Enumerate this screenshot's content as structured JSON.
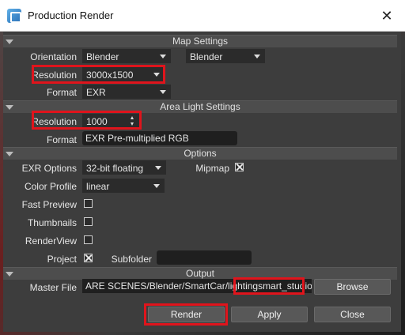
{
  "window": {
    "title": "Production Render",
    "close_glyph": "✕"
  },
  "sections": {
    "map": "Map Settings",
    "area": "Area Light Settings",
    "options": "Options",
    "output": "Output"
  },
  "map_settings": {
    "orientation_label": "Orientation",
    "orientation_value_1": "Blender",
    "orientation_value_2": "Blender",
    "resolution_label": "Resolution",
    "resolution_value": "3000x1500",
    "format_label": "Format",
    "format_value": "EXR"
  },
  "area_light": {
    "resolution_label": "Resolution",
    "resolution_value": "1000",
    "format_label": "Format",
    "format_value": "EXR Pre-multiplied RGB"
  },
  "options": {
    "exr_label": "EXR Options",
    "exr_value": "32-bit floating",
    "mipmap_label": "Mipmap",
    "mipmap_checked": true,
    "color_profile_label": "Color Profile",
    "color_profile_value": "linear",
    "fast_preview_label": "Fast Preview",
    "thumbnails_label": "Thumbnails",
    "renderview_label": "RenderView",
    "project_label": "Project",
    "project_checked": true,
    "subfolder_label": "Subfolder",
    "subfolder_value": ""
  },
  "output": {
    "master_file_label": "Master File",
    "path_value": "ARE SCENES/Blender/SmartCar/lighting",
    "filename_value": "smart_studio.exr",
    "browse_label": "Browse"
  },
  "buttons": {
    "render": "Render",
    "apply": "Apply",
    "close": "Close"
  },
  "colors": {
    "highlight": "#e0141c",
    "panel": "#3d3d3d",
    "header": "#4d4d4d"
  }
}
